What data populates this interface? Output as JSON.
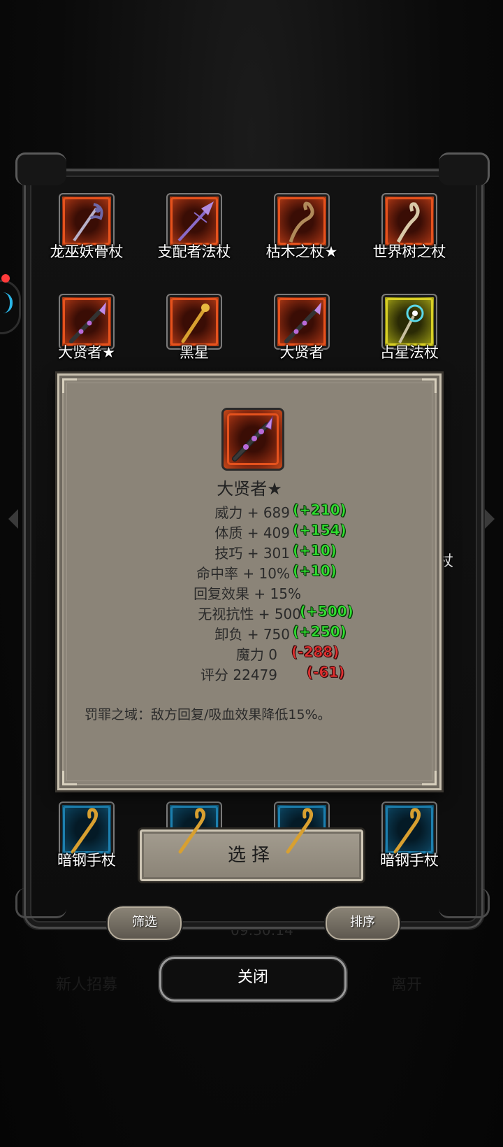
{
  "background": {
    "recruit_label": "新人招募",
    "leave_label": "离开",
    "timer": "09:30:14"
  },
  "items": [
    {
      "name": "龙巫妖骨杖",
      "frame": "red",
      "icon": "bone-staff-icon"
    },
    {
      "name": "支配者法杖",
      "frame": "red",
      "icon": "dominator-staff-icon"
    },
    {
      "name": "枯木之杖★",
      "frame": "red",
      "icon": "withered-wood-staff-icon"
    },
    {
      "name": "世界树之杖",
      "frame": "red",
      "icon": "world-tree-staff-icon"
    },
    {
      "name": "大贤者★",
      "frame": "red",
      "icon": "archsage-staff-icon"
    },
    {
      "name": "黑星",
      "frame": "red",
      "icon": "black-star-staff-icon"
    },
    {
      "name": "大贤者",
      "frame": "red",
      "icon": "archsage-staff-icon"
    },
    {
      "name": "占星法杖",
      "frame": "yellow",
      "icon": "astrology-staff-icon"
    },
    {
      "name": "暗钢手杖",
      "frame": "blue",
      "icon": "dark-steel-cane-icon"
    },
    {
      "name": "",
      "frame": "blue",
      "icon": "dark-steel-cane-icon"
    },
    {
      "name": "",
      "frame": "blue",
      "icon": "dark-steel-cane-icon"
    },
    {
      "name": "暗钢手杖",
      "frame": "blue",
      "icon": "dark-steel-cane-icon"
    }
  ],
  "partial_text": "杖",
  "detail": {
    "name": "大贤者★",
    "icon": "archsage-staff-icon",
    "stats": [
      {
        "label": "威力 + 689",
        "bonus": "(+210)",
        "sign": "pos"
      },
      {
        "label": "体质 + 409",
        "bonus": "(+154)",
        "sign": "pos"
      },
      {
        "label": "技巧 + 301",
        "bonus": "(+10)",
        "sign": "pos"
      },
      {
        "label": "命中率 + 10%",
        "bonus": "(+10)",
        "sign": "pos"
      },
      {
        "label": "回复效果 + 15%",
        "bonus": "",
        "sign": "pos"
      },
      {
        "label": "无视抗性 + 500",
        "bonus": "(+500)",
        "sign": "pos"
      },
      {
        "label": "卸负 + 750",
        "bonus": "(+250)",
        "sign": "pos"
      },
      {
        "label": "魔力  0",
        "bonus": "(-288)",
        "sign": "neg"
      },
      {
        "label": "评分 22479",
        "bonus": "(-61)",
        "sign": "neg"
      }
    ],
    "skill": "罚罪之域：敌方回复/吸血效果降低15%。"
  },
  "buttons": {
    "select": "选择",
    "filter": "筛选",
    "sort": "排序",
    "close": "关闭"
  },
  "colors": {
    "bonus_positive": "#2fe02f",
    "bonus_negative": "#e23030",
    "rare_frame": "#e5521d",
    "epic_frame": "#d8cf26",
    "common_frame": "#1d7fae"
  }
}
